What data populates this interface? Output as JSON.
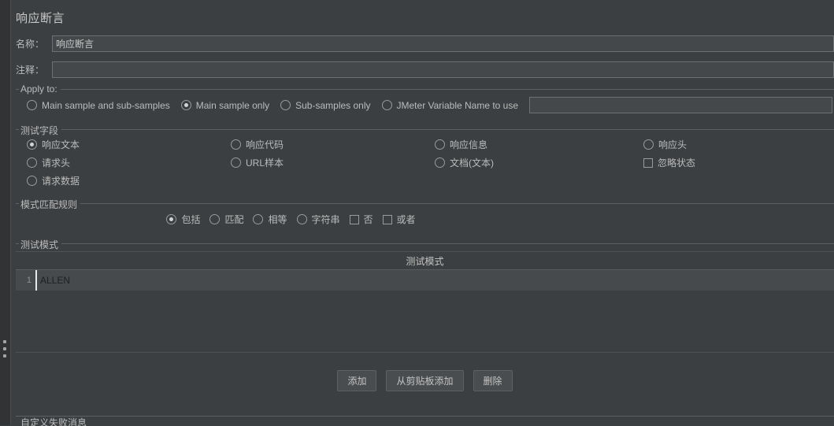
{
  "window": {
    "title": "响应断言"
  },
  "name_field": {
    "label": "名称：",
    "value": "响应断言",
    "placeholder": ""
  },
  "comment_field": {
    "label": "注释：",
    "value": "",
    "placeholder": ""
  },
  "apply_to": {
    "title": "Apply to:",
    "options": [
      {
        "label": "Main sample and sub-samples",
        "selected": false
      },
      {
        "label": "Main sample only",
        "selected": true
      },
      {
        "label": "Sub-samples only",
        "selected": false
      },
      {
        "label": "JMeter Variable Name to use",
        "selected": false
      }
    ],
    "variable_value": "",
    "variable_placeholder": ""
  },
  "test_field": {
    "title": "测试字段",
    "options": [
      {
        "label": "响应文本",
        "type": "radio",
        "selected": true
      },
      {
        "label": "响应代码",
        "type": "radio",
        "selected": false
      },
      {
        "label": "响应信息",
        "type": "radio",
        "selected": false
      },
      {
        "label": "响应头",
        "type": "radio",
        "selected": false
      },
      {
        "label": "请求头",
        "type": "radio",
        "selected": false
      },
      {
        "label": "URL样本",
        "type": "radio",
        "selected": false
      },
      {
        "label": "文档(文本)",
        "type": "radio",
        "selected": false
      },
      {
        "label": "忽略状态",
        "type": "checkbox",
        "selected": false
      },
      {
        "label": "请求数据",
        "type": "radio",
        "selected": false
      }
    ]
  },
  "pattern_rules": {
    "title": "模式匹配规则",
    "options": [
      {
        "label": "包括",
        "type": "radio",
        "selected": true
      },
      {
        "label": "匹配",
        "type": "radio",
        "selected": false
      },
      {
        "label": "相等",
        "type": "radio",
        "selected": false
      },
      {
        "label": "字符串",
        "type": "radio",
        "selected": false
      },
      {
        "label": "否",
        "type": "checkbox",
        "selected": false
      },
      {
        "label": "或者",
        "type": "checkbox",
        "selected": false
      }
    ]
  },
  "test_patterns": {
    "title": "测试模式",
    "column_header": "测试模式",
    "rows": [
      {
        "num": "1",
        "value": "ALLEN"
      }
    ]
  },
  "buttons": {
    "add": "添加",
    "add_from_clipboard": "从剪贴板添加",
    "delete": "删除"
  },
  "footer": {
    "title": "自定义失败消息"
  },
  "colors": {
    "panel_bg": "#3c3f41",
    "gutter_bg": "#313335",
    "input_bg": "#45484a",
    "border": "#5e6163",
    "text": "#bbbbbb",
    "row_bg": "#474a4c",
    "caret": "#e8e8e8"
  }
}
